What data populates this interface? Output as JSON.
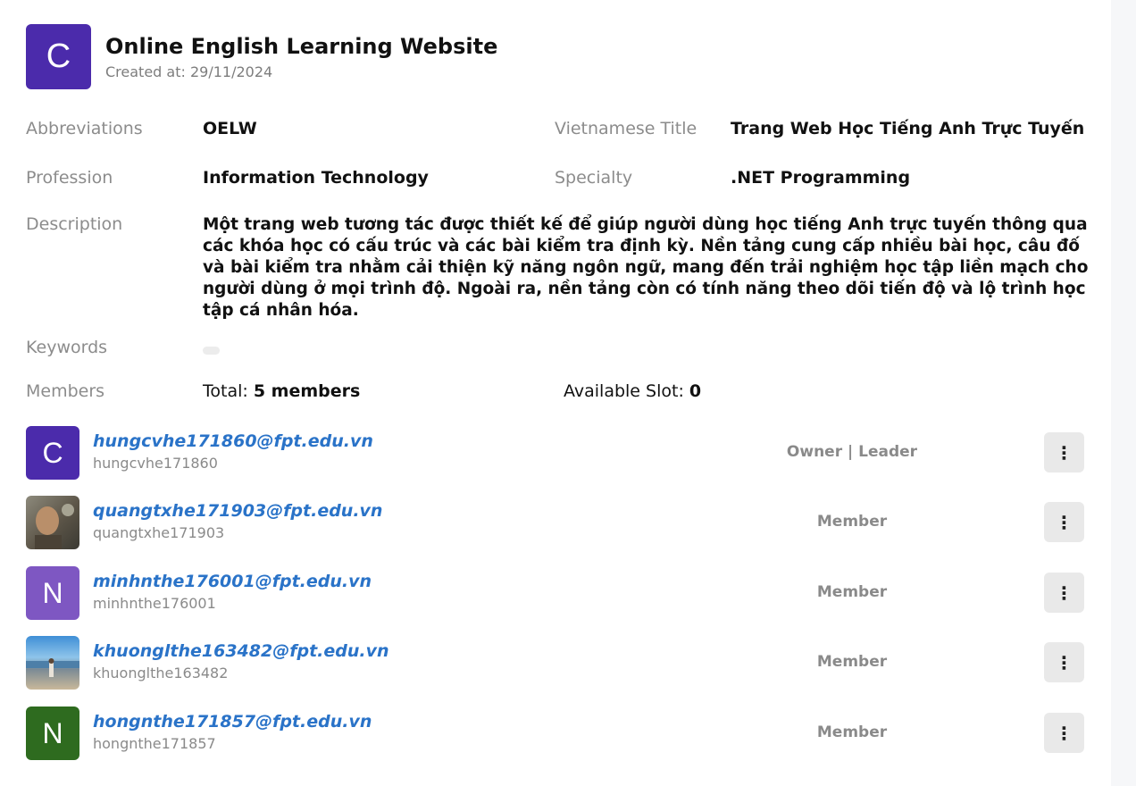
{
  "project": {
    "avatar_letter": "C",
    "avatar_color": "#4b2bab",
    "title": "Online English Learning Website",
    "created": "Created at: 29/11/2024"
  },
  "details": {
    "abbreviations_label": "Abbreviations",
    "abbreviations_value": "OELW",
    "vietnamese_title_label": "Vietnamese Title",
    "vietnamese_title_value": "Trang Web Học Tiếng Anh Trực Tuyến",
    "profession_label": "Profession",
    "profession_value": "Information Technology",
    "specialty_label": "Specialty",
    "specialty_value": ".NET Programming",
    "description_label": "Description",
    "description_value": "Một trang web tương tác được thiết kế để giúp người dùng học tiếng Anh trực tuyến thông qua các khóa học có cấu trúc và các bài kiểm tra định kỳ. Nền tảng cung cấp nhiều bài học, câu đố và bài kiểm tra nhằm cải thiện kỹ năng ngôn ngữ, mang đến trải nghiệm học tập liền mạch cho người dùng ở mọi trình độ. Ngoài ra, nền tảng còn có tính năng theo dõi tiến độ và lộ trình học tập cá nhân hóa.",
    "keywords_label": "Keywords",
    "members_label": "Members",
    "total_prefix": "Total: ",
    "total_value": "5 members",
    "slot_prefix": "Available Slot: ",
    "slot_value": "0"
  },
  "members": [
    {
      "avatar_letter": "C",
      "avatar_color": "#4b2bab",
      "email": "hungcvhe171860@fpt.edu.vn",
      "username": "hungcvhe171860",
      "role": "Owner | Leader",
      "menu_icon": "⋮"
    },
    {
      "avatar_letter": "",
      "avatar_color": "#6b6b5e",
      "email": "quangtxhe171903@fpt.edu.vn",
      "username": "quangtxhe171903",
      "role": "Member",
      "menu_icon": "⋮"
    },
    {
      "avatar_letter": "N",
      "avatar_color": "#7e57c2",
      "email": "minhnthe176001@fpt.edu.vn",
      "username": "minhnthe176001",
      "role": "Member",
      "menu_icon": "⋮"
    },
    {
      "avatar_letter": "",
      "avatar_color": "#5fa3d6",
      "email": "khuonglthe163482@fpt.edu.vn",
      "username": "khuonglthe163482",
      "role": "Member",
      "menu_icon": "⋮"
    },
    {
      "avatar_letter": "N",
      "avatar_color": "#2e6b1f",
      "email": "hongnthe171857@fpt.edu.vn",
      "username": "hongnthe171857",
      "role": "Member",
      "menu_icon": "⋮"
    }
  ]
}
